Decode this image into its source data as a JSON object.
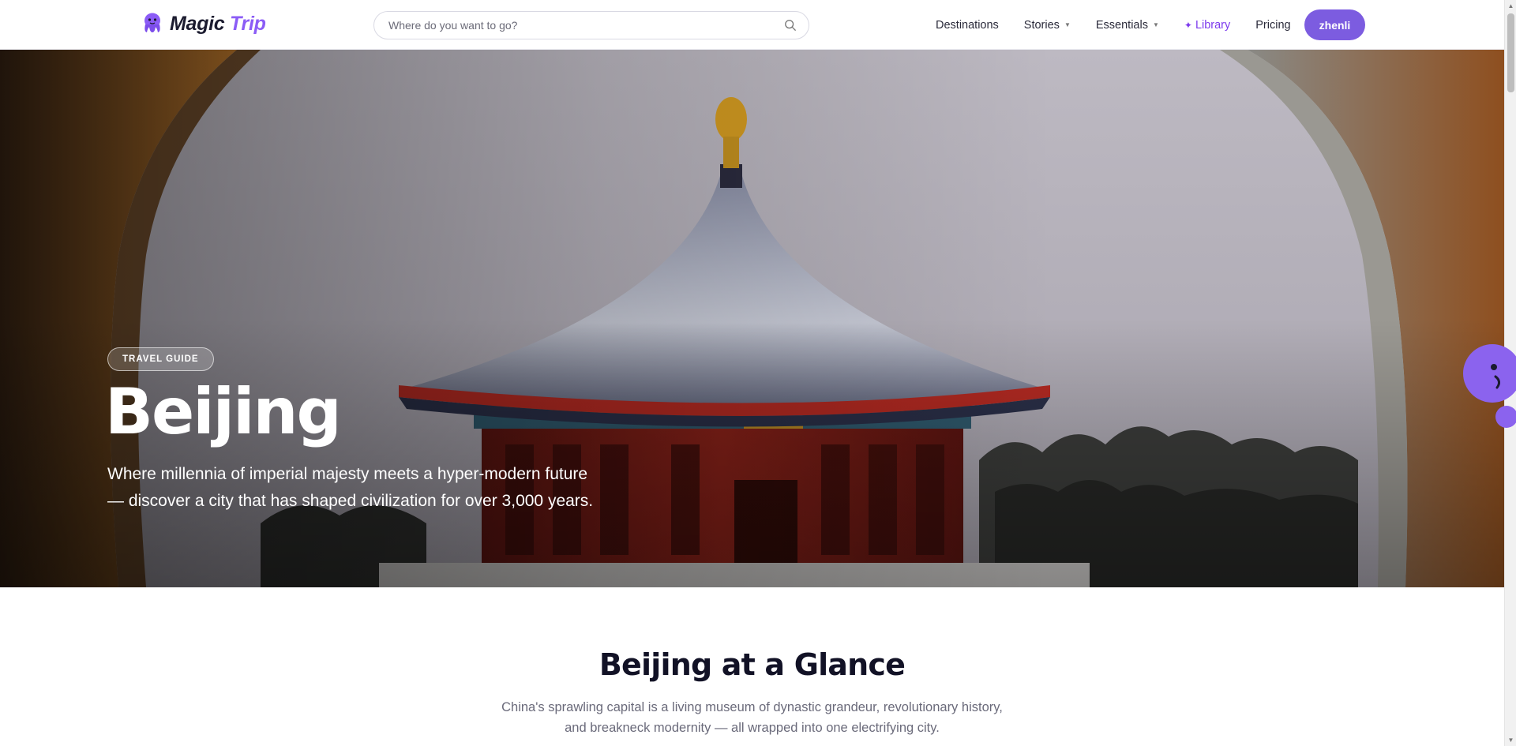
{
  "nav": {
    "logo_word1": "Magic",
    "logo_word2": "Trip",
    "search_placeholder": "Where do you want to go?",
    "links": {
      "destinations": "Destinations",
      "stories": "Stories",
      "essentials": "Essentials",
      "library": "Library",
      "pricing": "Pricing"
    },
    "user_label": "zhenli"
  },
  "hero": {
    "badge": "TRAVEL GUIDE",
    "title": "Beijing",
    "subtitle": "Where millennia of imperial majesty meets a hyper-modern future — discover a city that has shaped civilization for over 3,000 years."
  },
  "glance": {
    "title": "Beijing at a Glance",
    "description": "China's sprawling capital is a living museum of dynastic grandeur, revolutionary history, and breakneck modernity — all wrapped into one electrifying city."
  },
  "colors": {
    "brand": "#8b5cf6",
    "user_button": "#7c5ce0",
    "library_link": "#7c3aed"
  },
  "icons": {
    "logo": "octopus-icon",
    "search": "search-icon",
    "caret": "chevron-down-icon",
    "library": "sparkle-icon",
    "mascot": "octopus-mascot-icon"
  }
}
